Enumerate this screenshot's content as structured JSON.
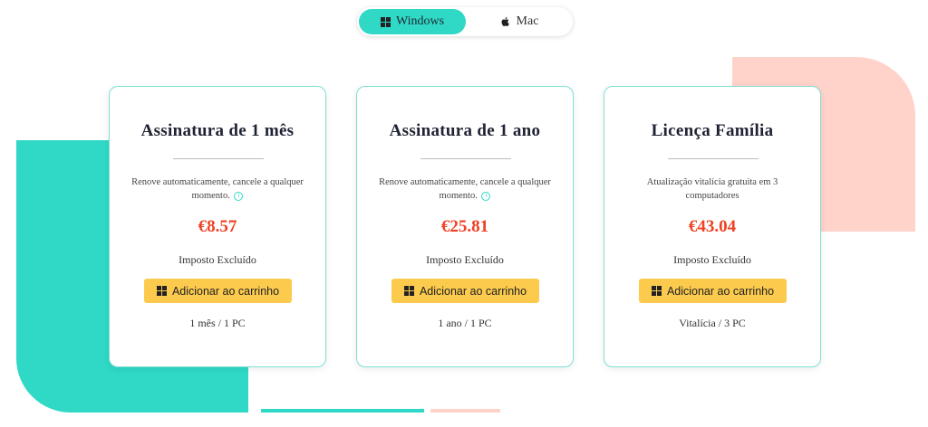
{
  "colors": {
    "accent_teal": "#2fd9c5",
    "accent_pink": "#ffd3ca",
    "price_red": "#ef4123",
    "button_yellow": "#fccb4e"
  },
  "os_toggle": {
    "windows_label": "Windows",
    "mac_label": "Mac",
    "selected": "Windows"
  },
  "plans": [
    {
      "title": "Assinatura de 1 mês",
      "description": "Renove automaticamente, cancele a qualquer momento.",
      "has_info": true,
      "price": "€8.57",
      "tax_note": "Imposto Excluído",
      "button_label": "Adicionar ao carrinho",
      "footer": "1 mês / 1 PC"
    },
    {
      "title": "Assinatura de 1 ano",
      "description": "Renove automaticamente, cancele a qualquer momento.",
      "has_info": true,
      "price": "€25.81",
      "tax_note": "Imposto Excluído",
      "button_label": "Adicionar ao carrinho",
      "footer": "1 ano / 1 PC"
    },
    {
      "title": "Licença Família",
      "description": "Atualização vitalícia gratuita em 3 computadores",
      "has_info": false,
      "price": "€43.04",
      "tax_note": "Imposto Excluído",
      "button_label": "Adicionar ao carrinho",
      "footer": "Vitalícia / 3 PC"
    }
  ],
  "icons": {
    "windows": "windows-icon",
    "apple": "apple-icon",
    "info": "info-icon"
  }
}
